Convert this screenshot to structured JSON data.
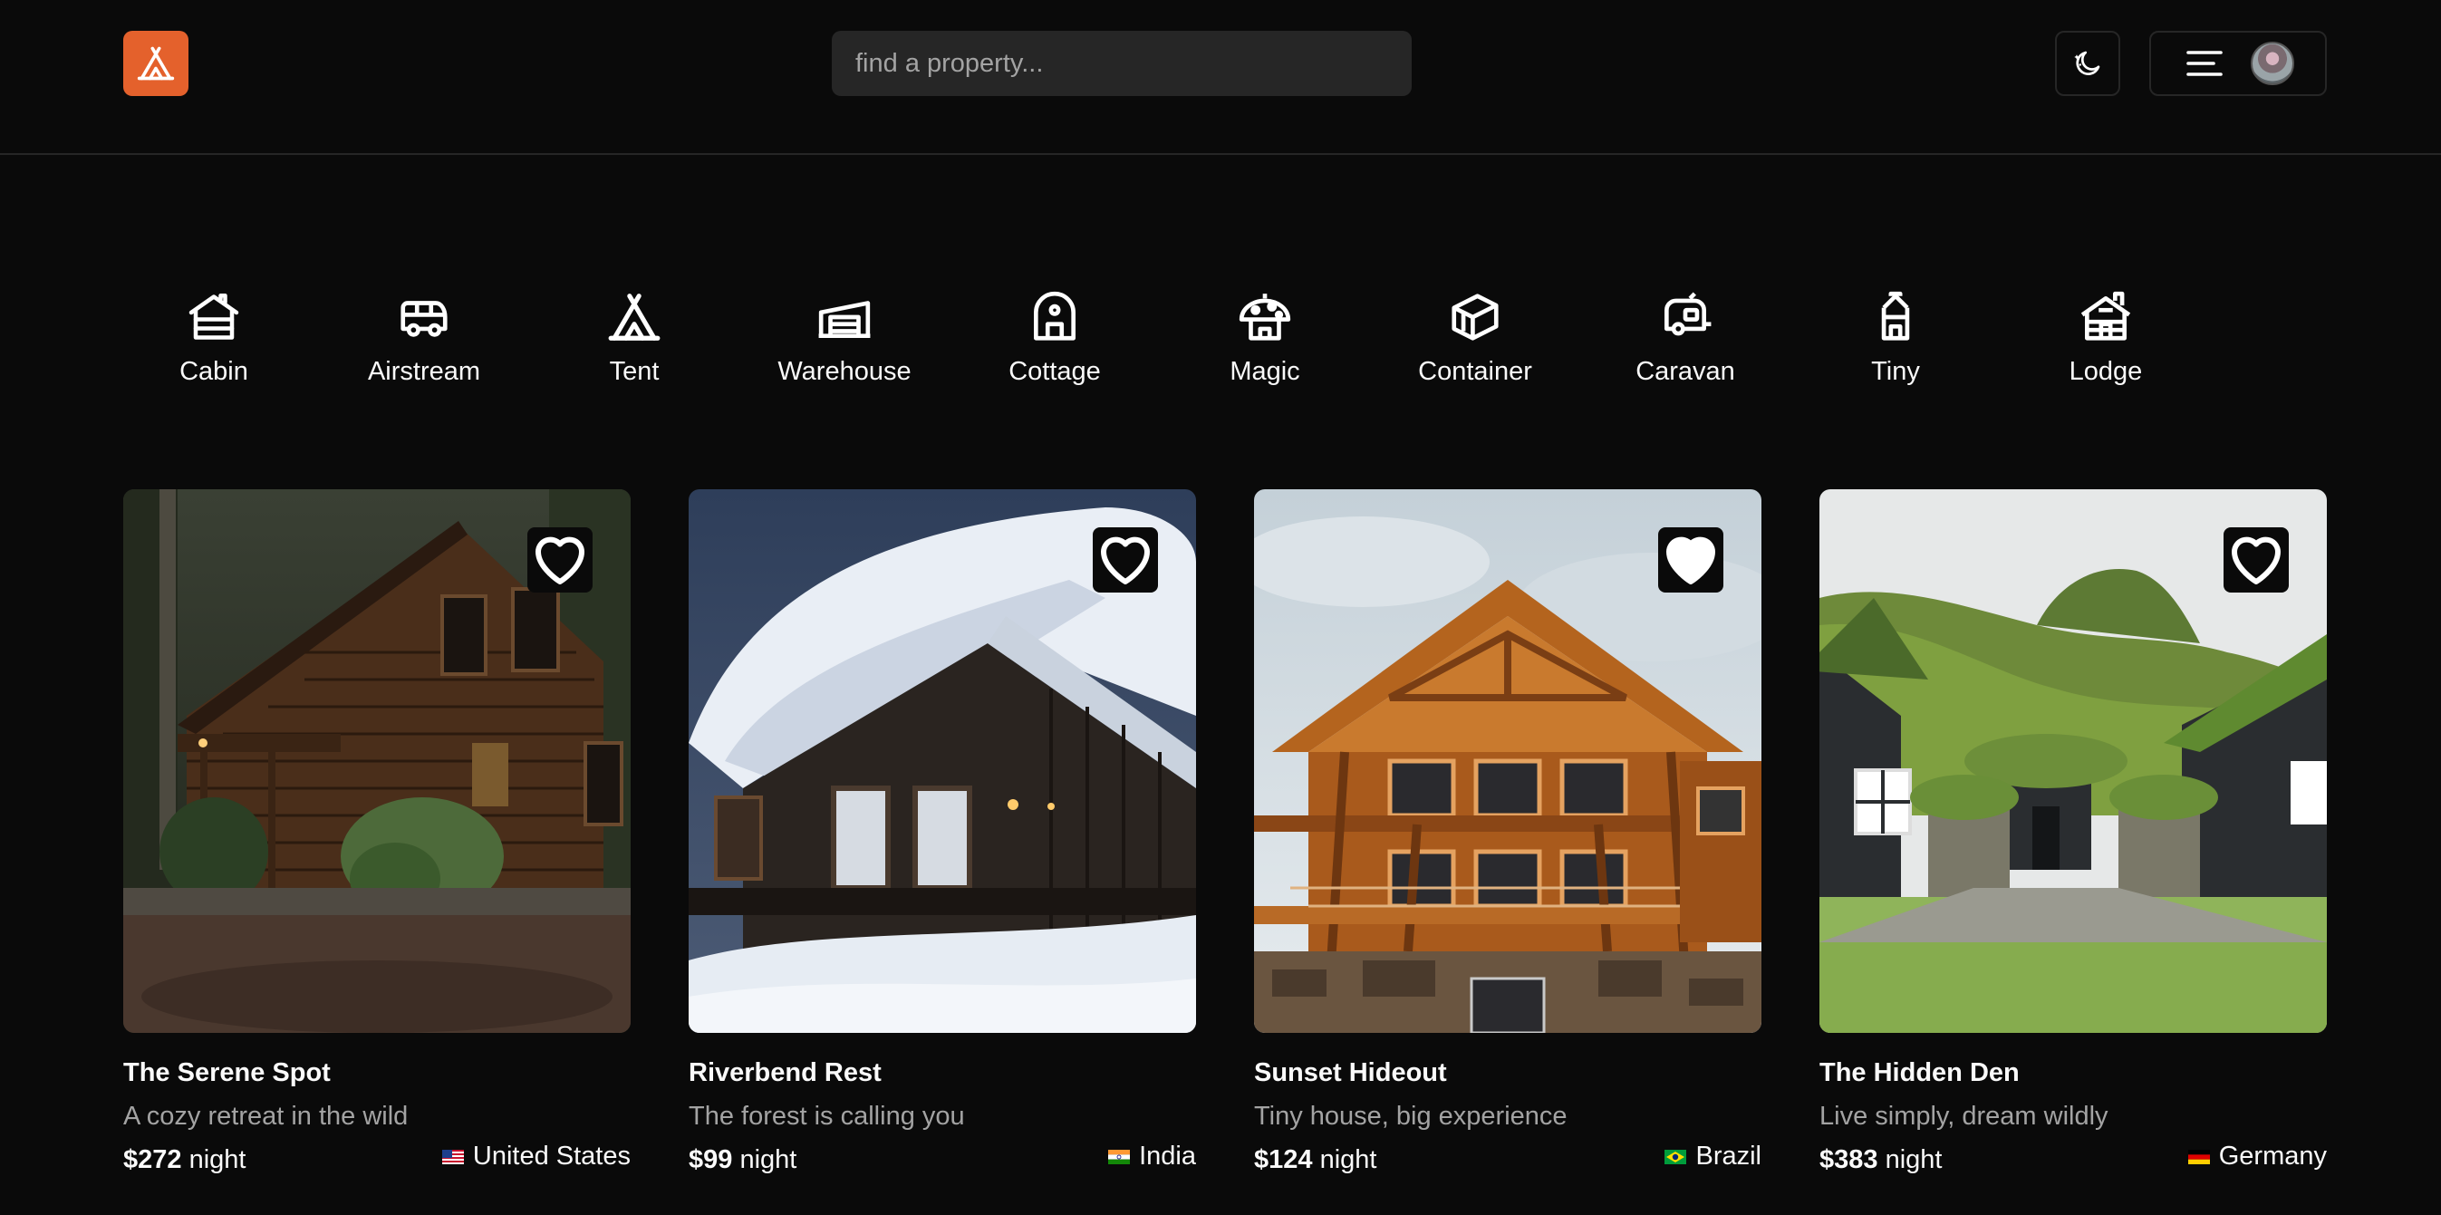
{
  "navbar": {
    "logo_icon": "tent-icon",
    "search": {
      "placeholder": "find a property...",
      "value": ""
    },
    "theme_icon": "moon-stars-icon",
    "menu_icon": "hamburger-menu-icon",
    "accent_color": "#e4612c"
  },
  "categories": [
    {
      "label": "Cabin",
      "icon": "cabin-icon"
    },
    {
      "label": "Airstream",
      "icon": "airstream-icon"
    },
    {
      "label": "Tent",
      "icon": "tent-icon"
    },
    {
      "label": "Warehouse",
      "icon": "warehouse-icon"
    },
    {
      "label": "Cottage",
      "icon": "cottage-icon"
    },
    {
      "label": "Magic",
      "icon": "mushroom-house-icon"
    },
    {
      "label": "Container",
      "icon": "container-icon"
    },
    {
      "label": "Caravan",
      "icon": "caravan-icon"
    },
    {
      "label": "Tiny",
      "icon": "tiny-house-icon"
    },
    {
      "label": "Lodge",
      "icon": "lodge-icon"
    }
  ],
  "properties": [
    {
      "name": "The Serene Spot",
      "tagline": "A cozy retreat in the wild",
      "price": "$272",
      "unit": "night",
      "country": "United States",
      "flag": "us-flag-icon",
      "favorited": false
    },
    {
      "name": "Riverbend Rest",
      "tagline": "The forest is calling you",
      "price": "$99",
      "unit": "night",
      "country": "India",
      "flag": "india-flag-icon",
      "favorited": false
    },
    {
      "name": "Sunset Hideout",
      "tagline": "Tiny house, big experience",
      "price": "$124",
      "unit": "night",
      "country": "Brazil",
      "flag": "brazil-flag-icon",
      "favorited": true
    },
    {
      "name": "The Hidden Den",
      "tagline": "Live simply, dream wildly",
      "price": "$383",
      "unit": "night",
      "country": "Germany",
      "flag": "germany-flag-icon",
      "favorited": false
    }
  ]
}
